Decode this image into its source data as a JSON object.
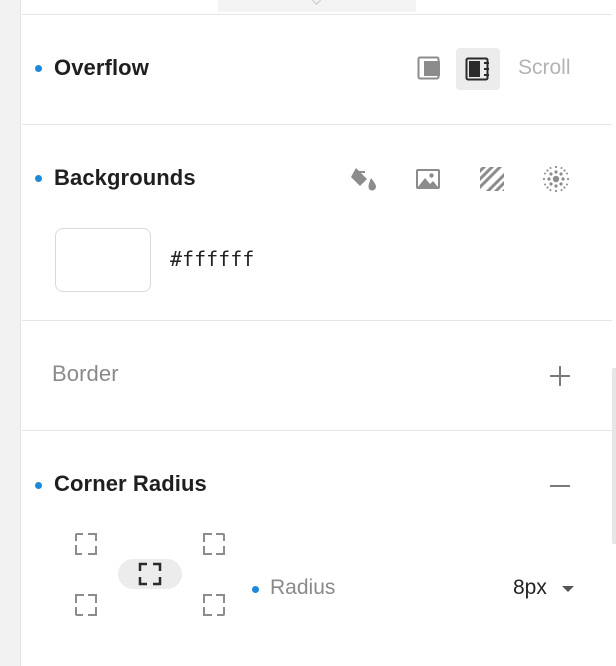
{
  "overflow": {
    "title": "Overflow",
    "modes": [
      {
        "icon": "overflow-visible-icon",
        "active": false
      },
      {
        "icon": "overflow-hidden-icon",
        "active": true
      }
    ],
    "scroll_label": "Scroll"
  },
  "backgrounds": {
    "title": "Backgrounds",
    "types": [
      "paint-bucket-icon",
      "image-icon",
      "pattern-stripes-icon",
      "gradient-radial-icon"
    ],
    "color_hex": "#ffffff"
  },
  "border": {
    "title": "Border"
  },
  "corner_radius": {
    "title": "Corner Radius",
    "radius_label": "Radius",
    "radius_value": "8px"
  },
  "colors": {
    "accent_dot": "#1b8ad9",
    "divider": "#e6e6e6",
    "active_bg": "#ececec"
  }
}
